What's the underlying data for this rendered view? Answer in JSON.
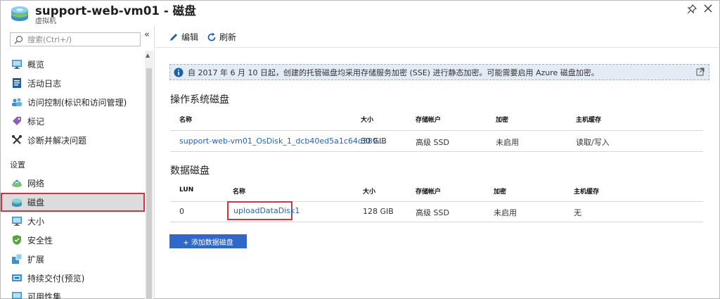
{
  "window": {
    "title": "support-web-vm01 - 磁盘",
    "subtitle": "虚拟机"
  },
  "sidebar": {
    "search_placeholder": "搜索(Ctrl+/)",
    "items": [
      {
        "label": "概览",
        "icon": "monitor-icon"
      },
      {
        "label": "活动日志",
        "icon": "log-icon"
      },
      {
        "label": "访问控制(标识和访问管理)",
        "icon": "people-icon"
      },
      {
        "label": "标记",
        "icon": "tag-icon"
      },
      {
        "label": "诊断并解决问题",
        "icon": "wrench-icon"
      }
    ],
    "section_label": "设置",
    "settings_items": [
      {
        "label": "网络",
        "icon": "network-icon"
      },
      {
        "label": "磁盘",
        "icon": "disk-icon",
        "selected": true
      },
      {
        "label": "大小",
        "icon": "monitor-icon"
      },
      {
        "label": "安全性",
        "icon": "shield-icon"
      },
      {
        "label": "扩展",
        "icon": "extension-icon"
      },
      {
        "label": "持续交付(预览)",
        "icon": "delivery-icon"
      },
      {
        "label": "可用性集",
        "icon": "availability-icon"
      }
    ]
  },
  "toolbar": {
    "edit_label": "编辑",
    "refresh_label": "刷新"
  },
  "banner": {
    "text": "自 2017 年 6 月 10 日起，创建的托管磁盘均采用存储服务加密 (SSE) 进行静态加密。可能需要启用 Azure 磁盘加密。"
  },
  "os_disk": {
    "title": "操作系统磁盘",
    "headers": {
      "name": "名称",
      "size": "大小",
      "storage": "存储帐户",
      "encryption": "加密",
      "cache": "主机缓存"
    },
    "row": {
      "name": "support-web-vm01_OsDisk_1_dcb40ed5a1c64d389...",
      "size": "30 GIB",
      "storage": "高级 SSD",
      "encryption": "未启用",
      "cache": "读取/写入"
    }
  },
  "data_disks": {
    "title": "数据磁盘",
    "headers": {
      "lun": "LUN",
      "name": "名称",
      "size": "大小",
      "storage": "存储帐户",
      "encryption": "加密",
      "cache": "主机缓存"
    },
    "row": {
      "lun": "0",
      "name": "uploadDataDisk1",
      "size": "128 GIB",
      "storage": "高级 SSD",
      "encryption": "未启用",
      "cache": "无"
    }
  },
  "add_button_label": "+ 添加数据磁盘",
  "colors": {
    "accent": "#2f68c8",
    "link": "#2664b2",
    "highlight": "#d8313e",
    "banner_bg": "#e3ebf4"
  }
}
